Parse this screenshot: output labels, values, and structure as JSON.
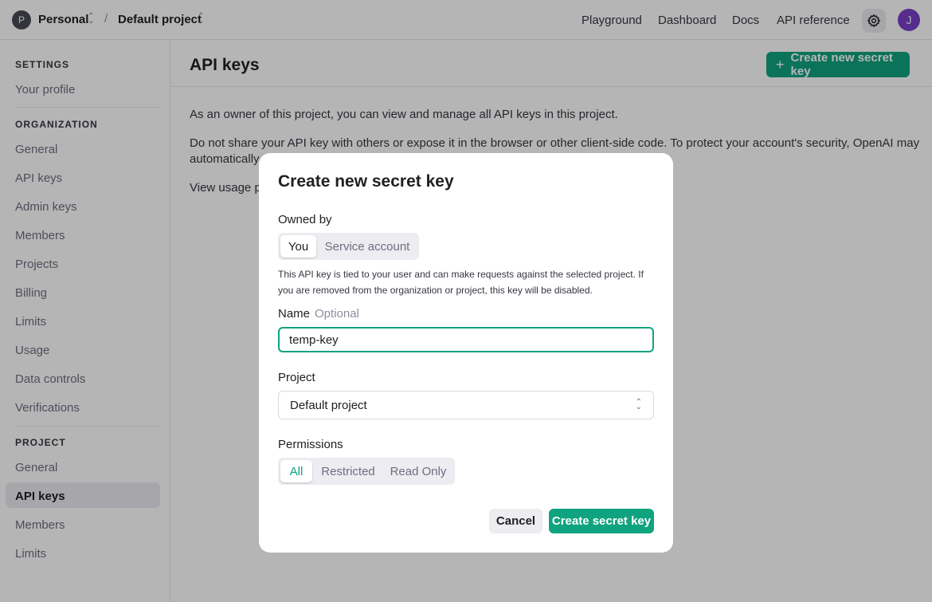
{
  "topbar": {
    "org_initial": "P",
    "org_name": "Personal",
    "separator": "/",
    "project_name": "Default project",
    "nav": [
      "Playground",
      "Dashboard",
      "Docs",
      "API reference"
    ],
    "user_initial": "J"
  },
  "sidebar": {
    "settings_heading": "SETTINGS",
    "your_profile": "Your profile",
    "organization_heading": "ORGANIZATION",
    "organization_items": [
      "General",
      "API keys",
      "Admin keys",
      "Members",
      "Projects",
      "Billing",
      "Limits",
      "Usage",
      "Data controls",
      "Verifications"
    ],
    "project_heading": "PROJECT",
    "project_items": [
      "General",
      "API keys",
      "Members",
      "Limits"
    ],
    "active_item": "API keys"
  },
  "main": {
    "title": "API keys",
    "create_button": "Create new secret key",
    "para1": "As an owner of this project, you can view and manage all API keys in this project.",
    "para2_line1": "Do not share your API key with others or expose it in the browser or other client-side code. To protect your account's security, OpenAI may",
    "para2_line2": "automatically d",
    "para3": "View usage pe"
  },
  "modal": {
    "title": "Create new secret key",
    "owned_by_label": "Owned by",
    "owned_by_options": [
      "You",
      "Service account"
    ],
    "owned_by_selected": "You",
    "help_text": "This API key is tied to your user and can make requests against the selected project. If you are removed from the organization or project, this key will be disabled.",
    "name_label": "Name",
    "name_optional": "Optional",
    "name_value": "temp-key",
    "project_label": "Project",
    "project_value": "Default project",
    "permissions_label": "Permissions",
    "permissions_options": [
      "All",
      "Restricted",
      "Read Only"
    ],
    "permissions_selected": "All",
    "cancel_button": "Cancel",
    "submit_button": "Create secret key"
  },
  "colors": {
    "accent": "#10a37f",
    "avatar_user": "#7a3ec6",
    "overlay": "rgba(0,0,0,0.29)"
  }
}
